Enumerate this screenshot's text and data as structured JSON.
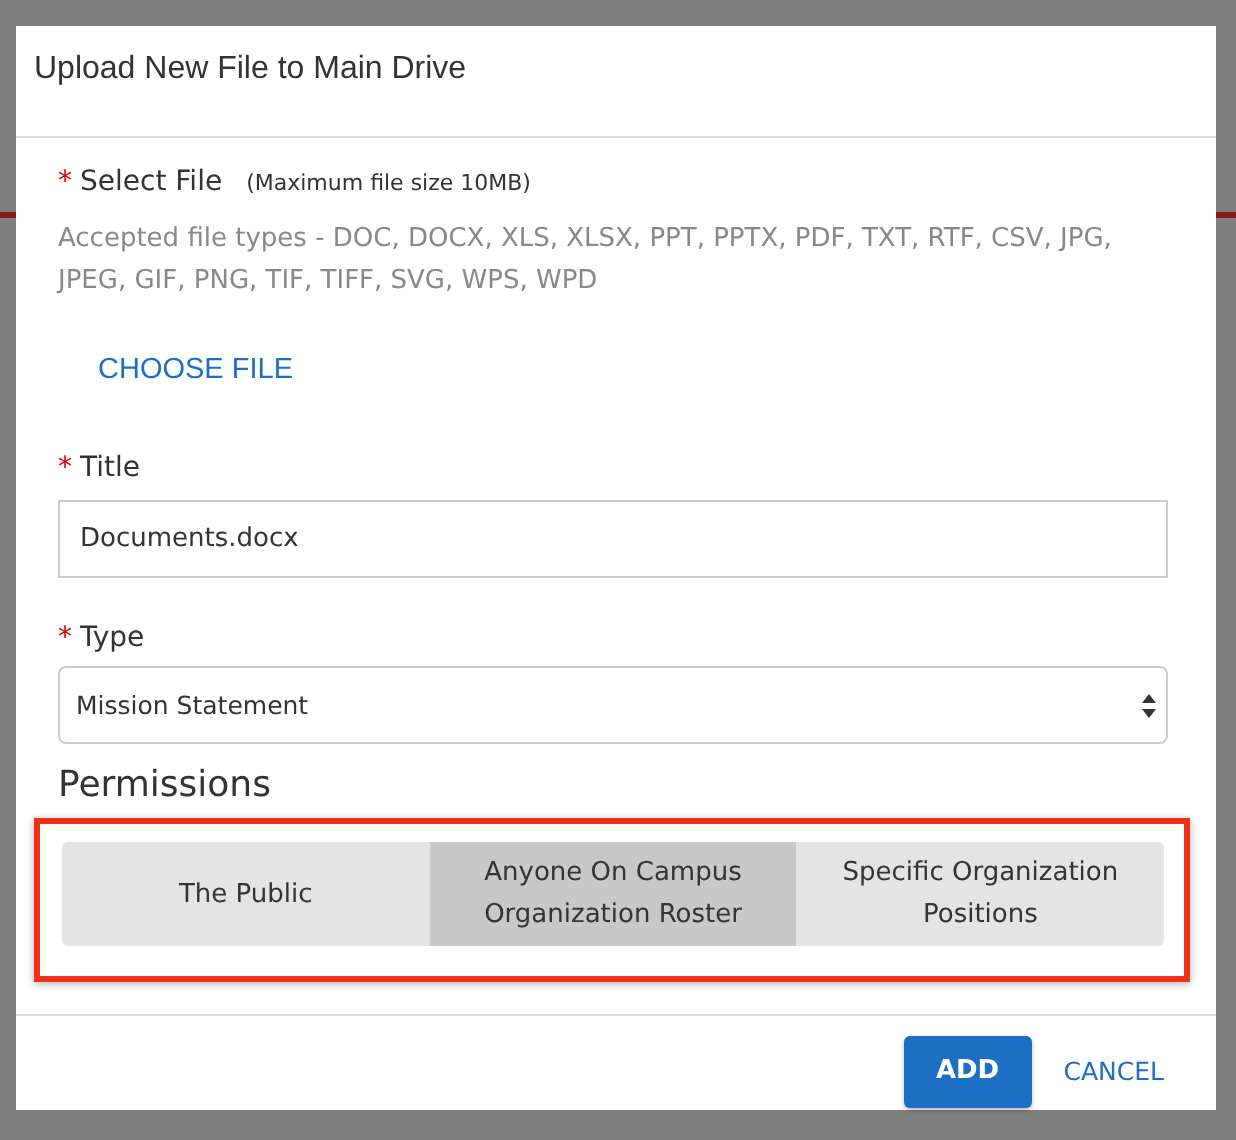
{
  "dialog": {
    "title": "Upload New File to Main Drive"
  },
  "select_file": {
    "label": "Select File",
    "required_mark": "*",
    "hint": "(Maximum file size 10MB)",
    "accepted": "Accepted file types - DOC, DOCX, XLS, XLSX, PPT, PPTX, PDF, TXT, RTF, CSV, JPG, JPEG, GIF, PNG, TIF, TIFF, SVG, WPS, WPD",
    "button": "CHOOSE FILE"
  },
  "title_field": {
    "label": "Title",
    "required_mark": "*",
    "value": "Documents.docx"
  },
  "type_field": {
    "label": "Type",
    "required_mark": "*",
    "value": "Mission Statement"
  },
  "permissions": {
    "heading": "Permissions",
    "highlighted": true,
    "options": [
      {
        "label": "The Public",
        "selected": false
      },
      {
        "label": "Anyone On Campus Organization Roster",
        "selected": true
      },
      {
        "label": "Specific Organization Positions",
        "selected": false
      }
    ]
  },
  "buttons": [
    {
      "label": "ADD",
      "kind": "primary"
    },
    {
      "label": "CANCEL",
      "kind": "link"
    }
  ]
}
